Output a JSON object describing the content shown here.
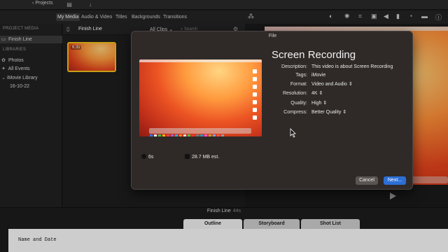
{
  "toolbar": {
    "projects_label": "Projects"
  },
  "browser_tabs": [
    {
      "label": "My Media",
      "active": true
    },
    {
      "label": "Audio & Video",
      "active": false
    },
    {
      "label": "Titles",
      "active": false
    },
    {
      "label": "Backgrounds",
      "active": false
    },
    {
      "label": "Transitions",
      "active": false
    }
  ],
  "sidebar": {
    "project_media_header": "PROJECT MEDIA",
    "project_item": "Finish Line",
    "libraries_header": "LIBRARIES",
    "items": [
      "Photos",
      "All Events",
      "iMovie Library",
      "16-10-22"
    ]
  },
  "browser": {
    "title": "Finish Line",
    "filter": "All Clips",
    "search_placeholder": "Search",
    "clip_duration": "6.3s"
  },
  "dialog": {
    "window_title": "File",
    "heading": "Screen Recording",
    "fields": [
      {
        "key": "Description:",
        "value": "This video is about Screen Recording"
      },
      {
        "key": "Tags:",
        "value": "iMovie"
      },
      {
        "key": "Format:",
        "value": "Video and Audio"
      },
      {
        "key": "Resolution:",
        "value": "4K"
      },
      {
        "key": "Quality:",
        "value": "High"
      },
      {
        "key": "Compress:",
        "value": "Better Quality"
      }
    ],
    "duration": "6s",
    "size": "28.7 MB est.",
    "cancel_label": "Cancel",
    "next_label": "Next..."
  },
  "timeline": {
    "title": "Finish Line",
    "duration": "44s",
    "tabs": [
      "Outline",
      "Storyboard",
      "Shot List"
    ],
    "active_tab": "Outline",
    "page_heading": "Name and Date"
  },
  "colors": {
    "accent": "#2c6fd6",
    "clip_border": "#f3c21a"
  }
}
